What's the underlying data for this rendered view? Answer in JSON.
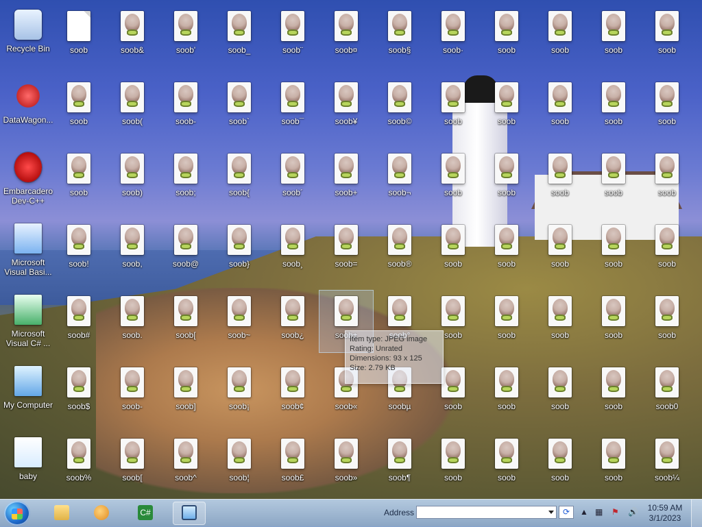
{
  "desktop": {
    "left_icons": [
      {
        "label": "Recycle Bin",
        "icon": "recycle-bin-icon"
      },
      {
        "label": "DataWagon...",
        "icon": "datawagon-icon"
      },
      {
        "label": "Embarcadero\nDev-C++",
        "icon": "devcpp-icon"
      },
      {
        "label": "Microsoft\nVisual Basi...",
        "icon": "vb-icon"
      },
      {
        "label": "Microsoft\nVisual C# ...",
        "icon": "csharp-icon"
      },
      {
        "label": "My Computer",
        "icon": "computer-icon"
      },
      {
        "label": "baby",
        "icon": "image-icon"
      }
    ],
    "grid_rows": [
      [
        "soob",
        "soob&",
        "soob'",
        "soob_",
        "soob¨",
        "soob¤",
        "soob§",
        "soob·",
        "soob",
        "soob",
        "soob",
        "soob"
      ],
      [
        "soob",
        "soob(",
        "soob-",
        "soob`",
        "soob¯",
        "soob¥",
        "soob©",
        "soob",
        "soob",
        "soob",
        "soob",
        "soob"
      ],
      [
        "soob",
        "soob)",
        "soob;",
        "soob{",
        "soob´",
        "soob+",
        "soob¬",
        "soob",
        "soob",
        "soob",
        "soob",
        "soob"
      ],
      [
        "soob!",
        "soob,",
        "soob@",
        "soob}",
        "soob¸",
        "soob=",
        "soob®",
        "soob",
        "soob",
        "soob",
        "soob",
        "soob"
      ],
      [
        "soob#",
        "soob.",
        "soob[",
        "soob~",
        "soob¿",
        "soob±",
        "soob°",
        "soob",
        "soob",
        "soob",
        "soob",
        "soob"
      ],
      [
        "soob$",
        "soob-",
        "soob]",
        "soob¡",
        "soob¢",
        "soob«",
        "soobµ",
        "soob",
        "soob",
        "soob",
        "soob",
        "soob0"
      ],
      [
        "soob%",
        "soob[",
        "soob^",
        "soob¦",
        "soob£",
        "soob»",
        "soob¶",
        "soob",
        "soob",
        "soob",
        "soob",
        "soob¼"
      ]
    ],
    "selected": {
      "row": 4,
      "col": 5
    }
  },
  "tooltip": {
    "item_type": "Item type: JPEG image",
    "rating": "Rating: Unrated",
    "dimensions": "Dimensions: 93 x 125",
    "size": "Size: 2.79 KB"
  },
  "taskbar": {
    "address_label": "Address",
    "address_value": "",
    "address_placeholder": "",
    "clock_time": "10:59 AM",
    "clock_date": "3/1/2023",
    "pinned": [
      {
        "name": "explorer-button",
        "icon": "folder-icon"
      },
      {
        "name": "media-player-button",
        "icon": "media-player-icon"
      },
      {
        "name": "visual-csharp-button",
        "icon": "csharp-icon"
      },
      {
        "name": "computer-button",
        "icon": "monitor-icon"
      }
    ]
  },
  "colors": {
    "accent": "#1e68c8",
    "taskbar": "#aec7ea",
    "label_shadow": "#000000"
  }
}
